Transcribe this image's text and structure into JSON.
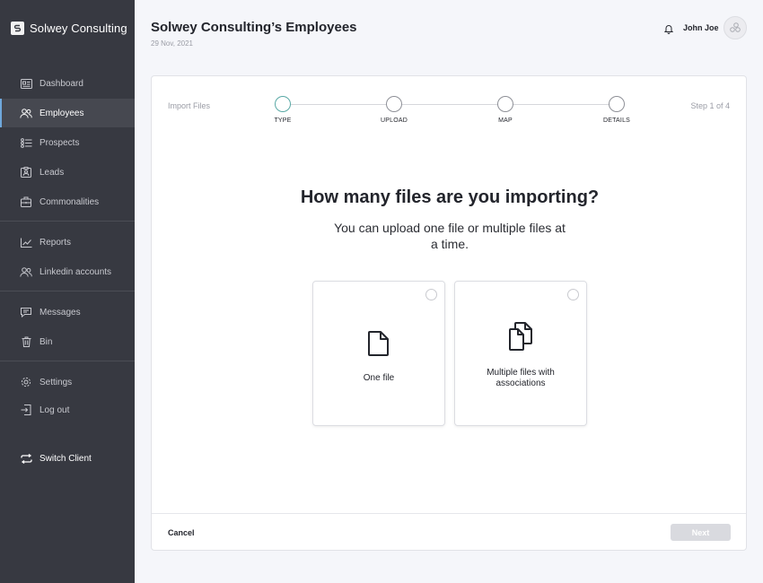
{
  "brand": {
    "name": "Solwey Consulting",
    "logo_icon": "s-logo-icon"
  },
  "sidebar": {
    "items": [
      {
        "label": "Dashboard",
        "icon": "dashboard-icon"
      },
      {
        "label": "Employees",
        "icon": "users-icon",
        "active": true
      },
      {
        "label": "Prospects",
        "icon": "checklist-icon"
      },
      {
        "label": "Leads",
        "icon": "badge-icon"
      },
      {
        "label": "Commonalities",
        "icon": "briefcase-icon"
      },
      {
        "label": "Reports",
        "icon": "chart-icon"
      },
      {
        "label": "Linkedin accounts",
        "icon": "users-icon"
      },
      {
        "label": "Messages",
        "icon": "message-icon"
      },
      {
        "label": "Bin",
        "icon": "trash-icon"
      },
      {
        "label": "Settings",
        "icon": "gear-icon"
      },
      {
        "label": "Log out",
        "icon": "logout-icon"
      },
      {
        "label": "Switch Client",
        "icon": "switch-icon"
      }
    ]
  },
  "header": {
    "title": "Solwey Consulting’s Employees",
    "date": "29 Nov, 2021",
    "user_name": "John Joe"
  },
  "wizard": {
    "label": "Import Files",
    "step_indicator": "Step 1 of 4",
    "steps": [
      {
        "label": "TYPE",
        "current": true
      },
      {
        "label": "UPLOAD"
      },
      {
        "label": "MAP"
      },
      {
        "label": "DETAILS"
      }
    ],
    "question": "How many files are you importing?",
    "subtitle": "You can upload one file or multiple files at a time.",
    "options": [
      {
        "label": "One file",
        "icon": "file-icon"
      },
      {
        "label": "Multiple files with associations",
        "icon": "files-icon"
      }
    ],
    "cancel_label": "Cancel",
    "next_label": "Next"
  },
  "colors": {
    "sidebar_bg": "#373941",
    "active_item_bg": "#464850",
    "current_step": "#5aa9a6",
    "disabled_button": "#d9dadf"
  }
}
